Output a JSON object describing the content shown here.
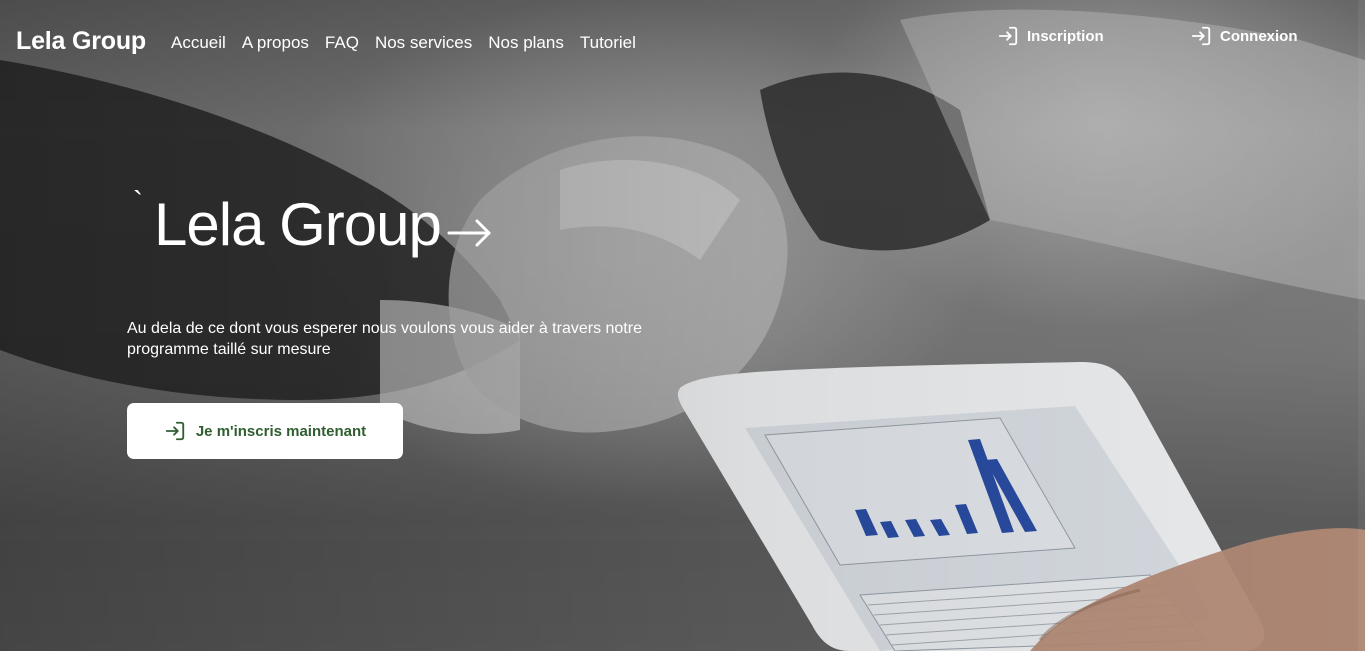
{
  "header": {
    "brand": "Lela Group",
    "nav": [
      {
        "label": "Accueil"
      },
      {
        "label": "A propos"
      },
      {
        "label": "FAQ"
      },
      {
        "label": "Nos services"
      },
      {
        "label": "Nos plans"
      },
      {
        "label": "Tutoriel"
      }
    ],
    "signup_label": "Inscription",
    "login_label": "Connexion"
  },
  "hero": {
    "tick": "`",
    "title": "Lela Group",
    "subtitle": "Au dela de ce dont vous esperer nous voulons vous aider à travers notre programme taillé sur mesure",
    "cta_label": "Je m'inscris maintenant",
    "background_description_icons": [
      "handshake",
      "tablet-chart"
    ]
  },
  "colors": {
    "cta_text": "#2f5e2f",
    "tablet_bar": "#2b4fa8"
  }
}
